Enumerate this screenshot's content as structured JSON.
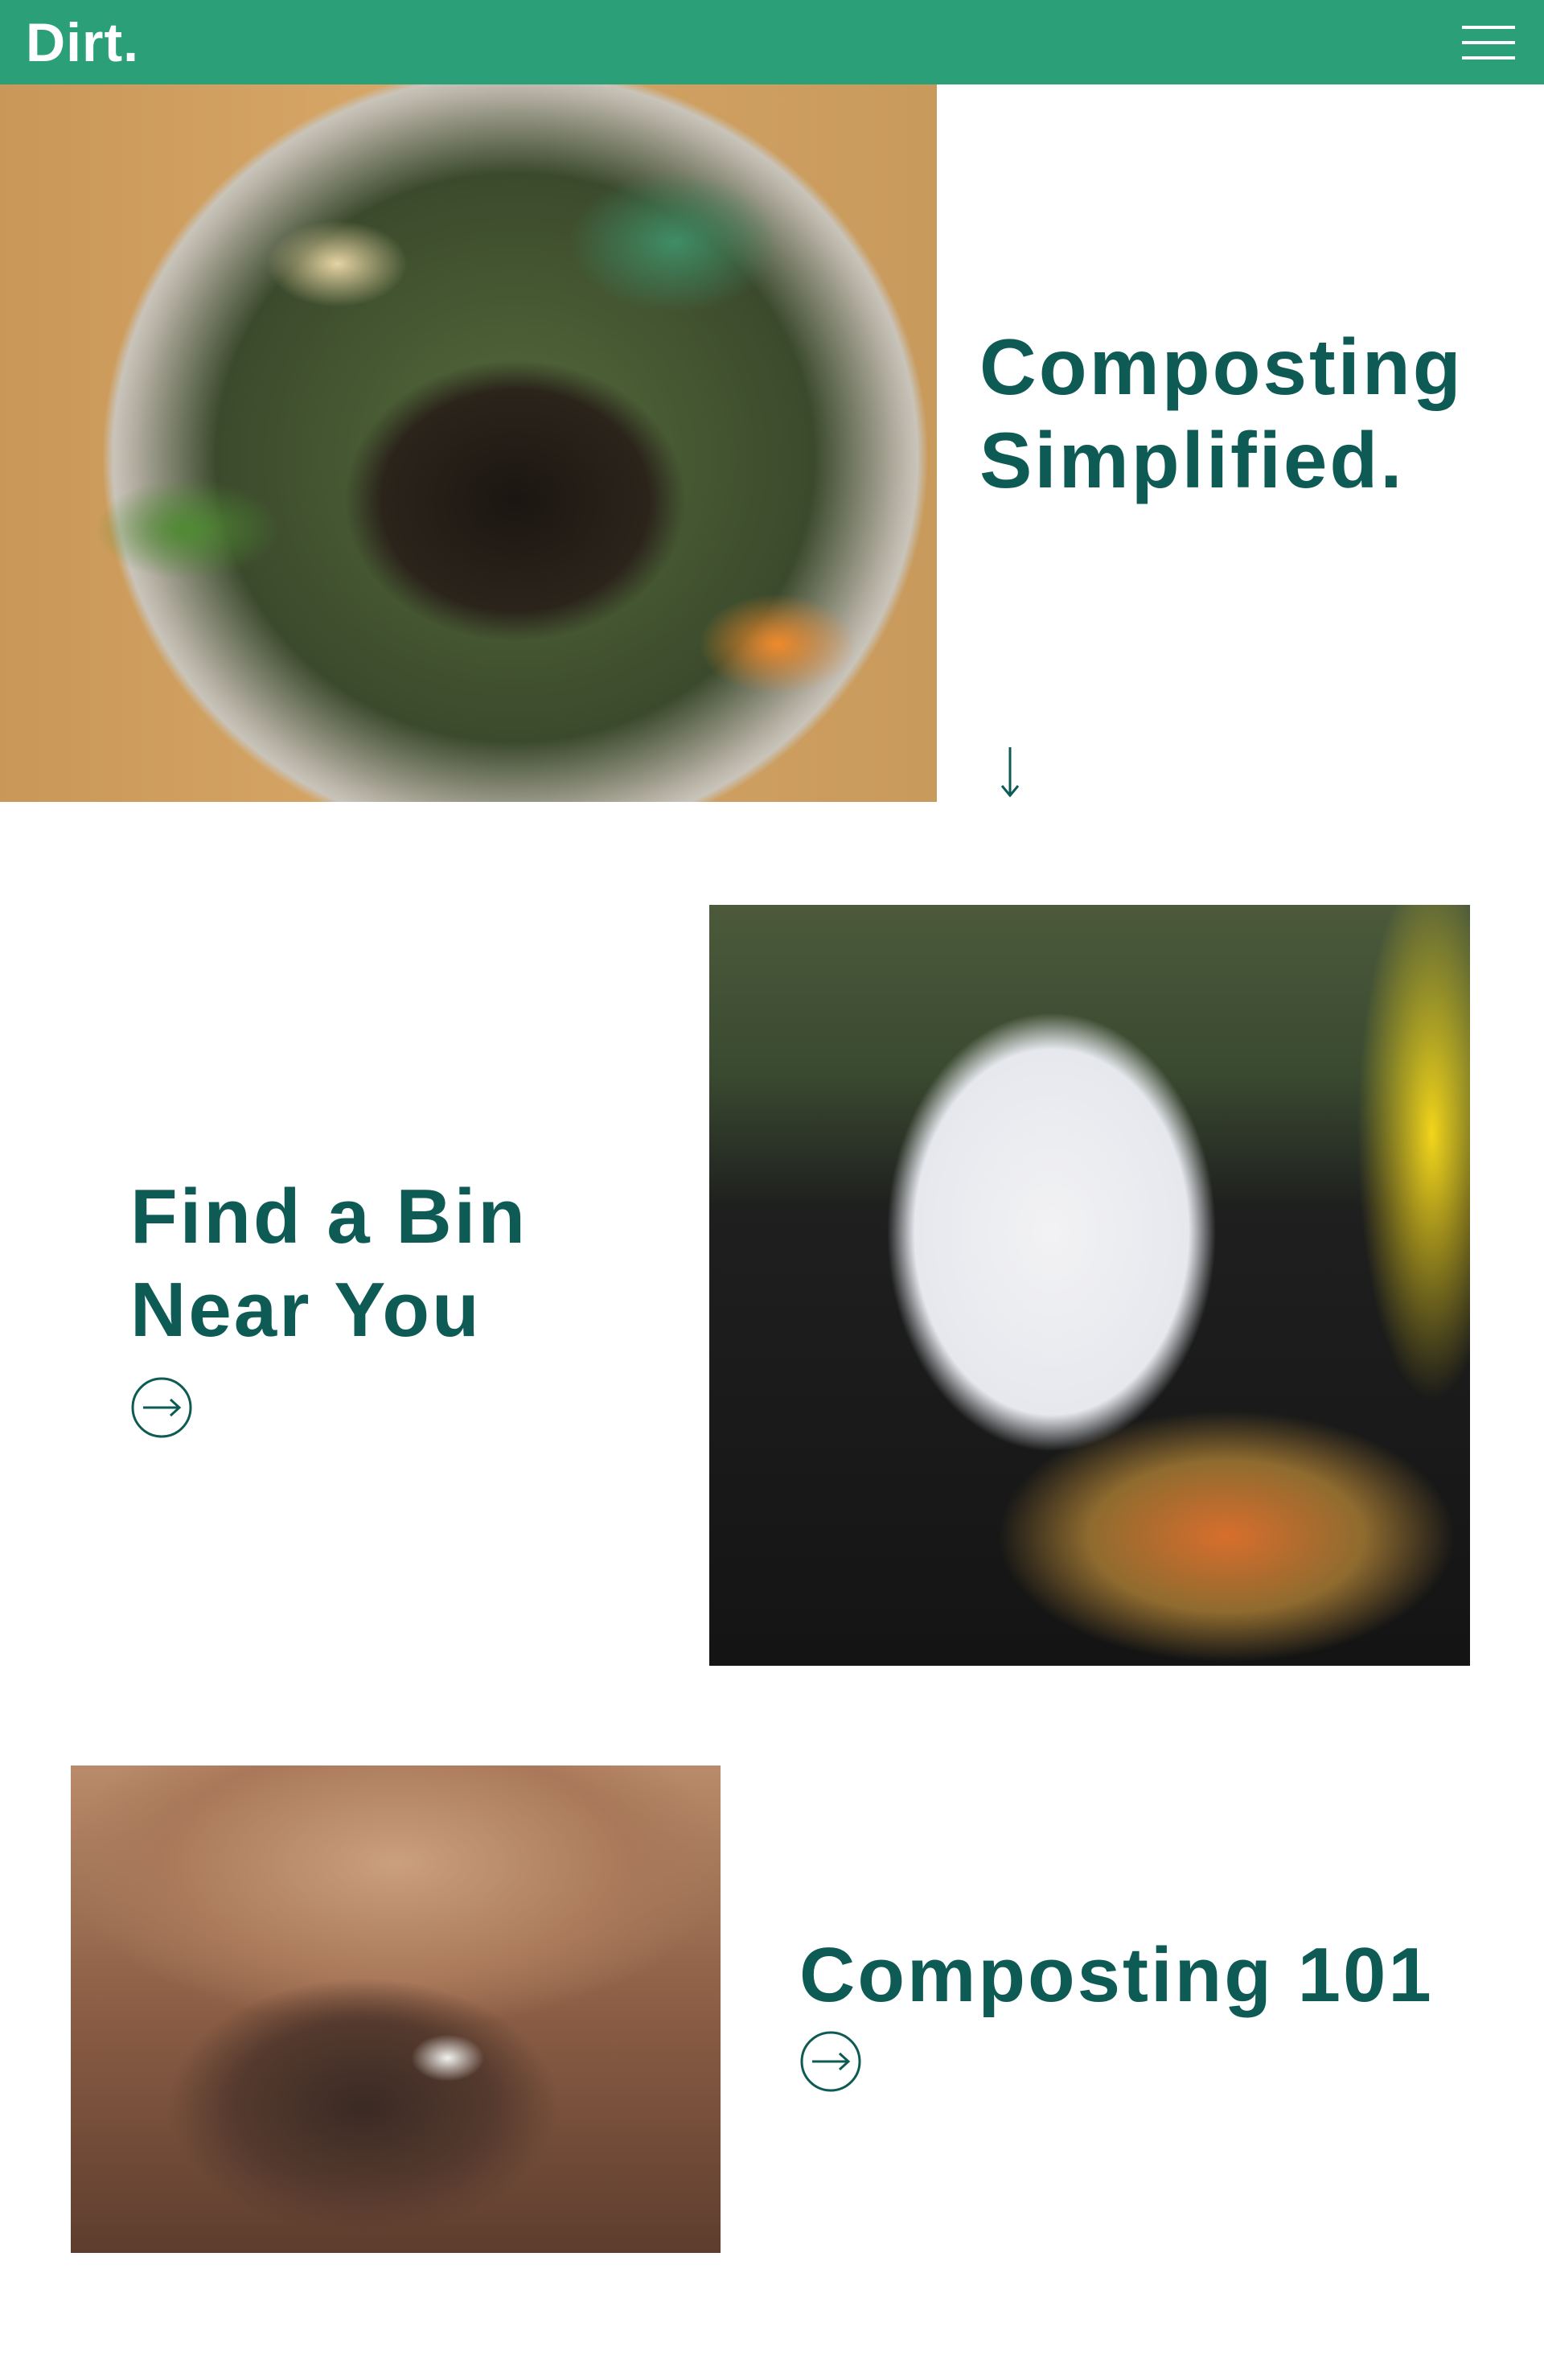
{
  "header": {
    "logo": "Dirt.",
    "menu_icon": "hamburger-menu-icon",
    "background_color": "#2a9f78"
  },
  "hero": {
    "title_line1": "Composting",
    "title_line2": "Simplified.",
    "image": "photo of food scraps and eggshells in a steel bowl",
    "scroll_icon": "down-arrow-icon"
  },
  "find_bin": {
    "title_line1": "Find a Bin",
    "title_line2": "Near You",
    "link_icon": "circle-right-arrow-icon",
    "image": "photo of food scraps being emptied from a plastic bag into a compost bin"
  },
  "composting_101": {
    "title": "Composting 101",
    "link_icon": "circle-right-arrow-icon",
    "image": "photo of compost scraps in a paper bag"
  },
  "colors": {
    "accent": "#2a9f78",
    "heading": "#0e5b56",
    "background": "#ffffff"
  }
}
